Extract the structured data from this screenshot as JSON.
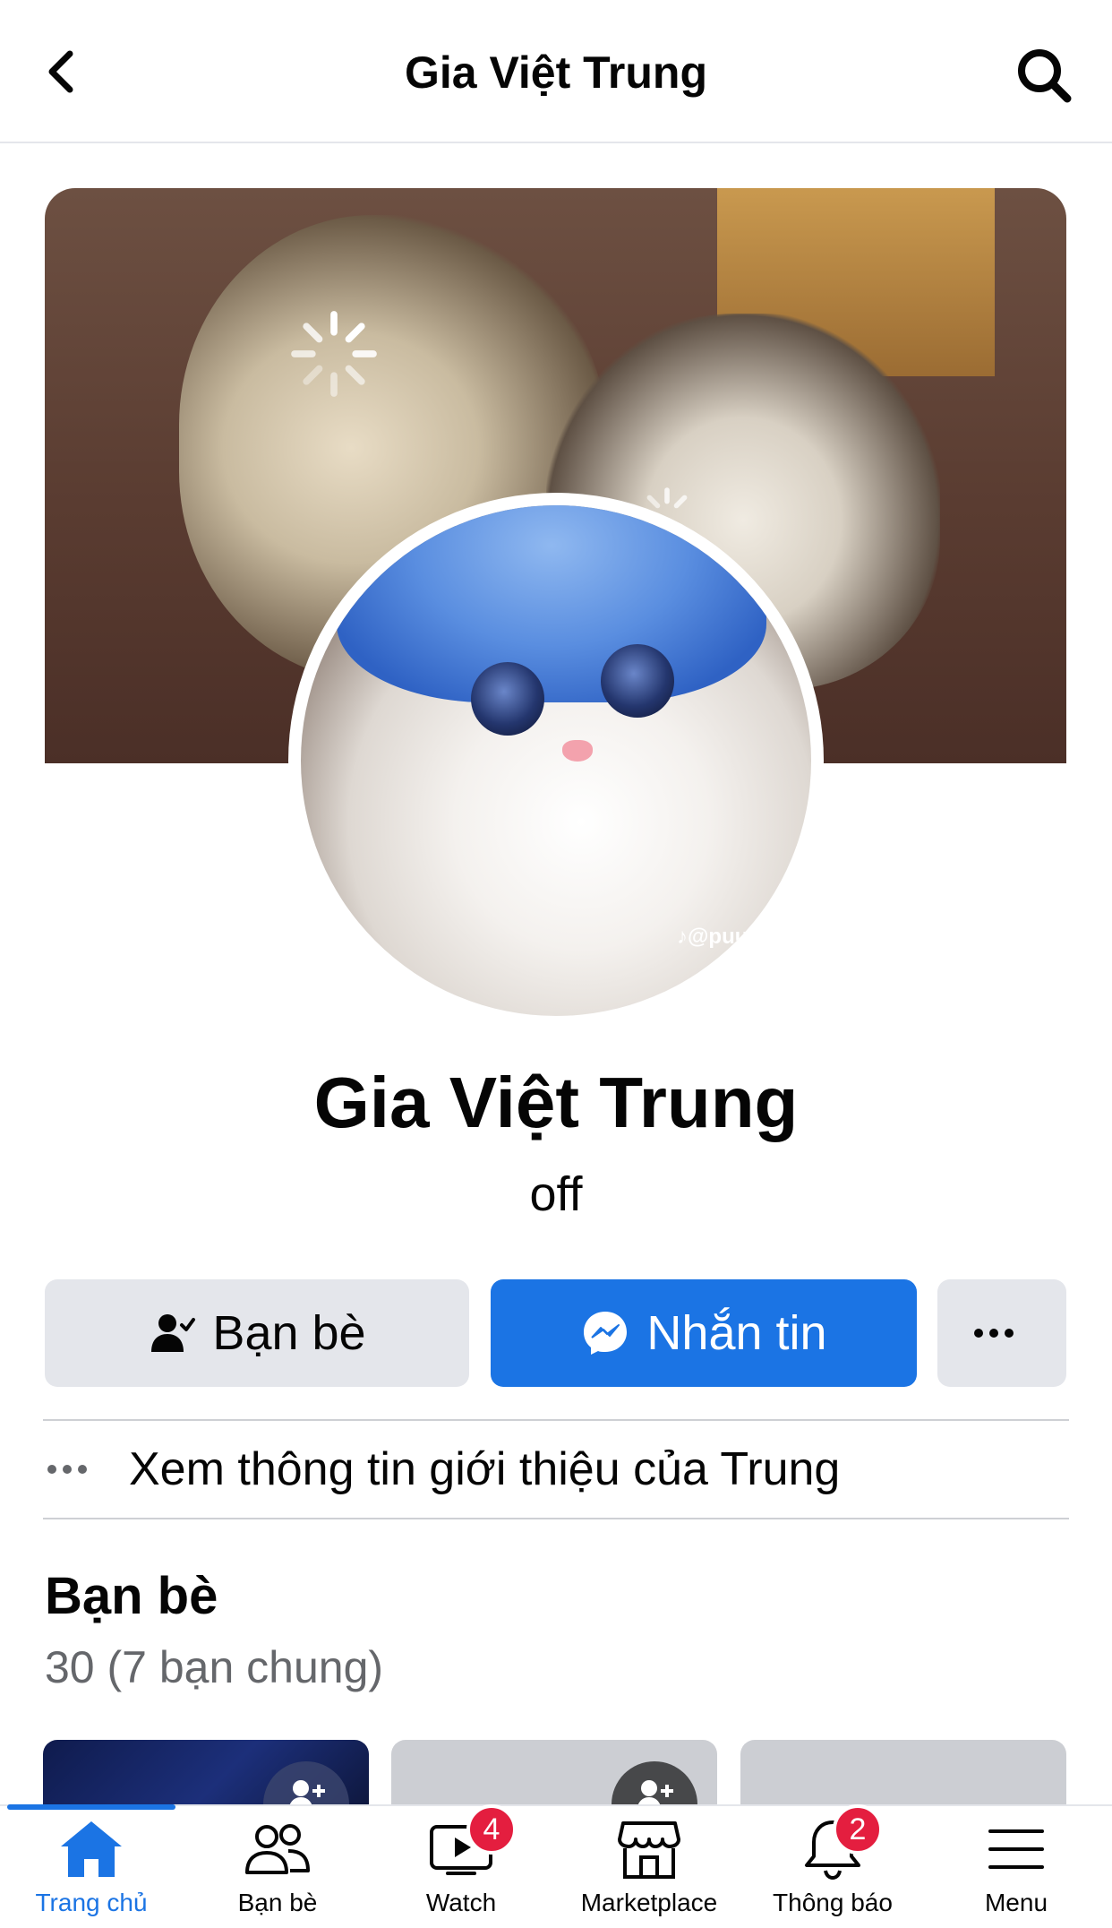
{
  "header": {
    "title": "Gia Việt Trung"
  },
  "profile": {
    "name": "Gia Việt Trung",
    "bio": "off",
    "avatar_watermark": "♪@puu"
  },
  "actions": {
    "friends_label": "Bạn bè",
    "message_label": "Nhắn tin"
  },
  "about": {
    "label": "Xem thông tin giới thiệu của Trung"
  },
  "friends": {
    "title": "Bạn bè",
    "count": "30 (7 bạn chung)"
  },
  "tabs": [
    {
      "label": "Trang chủ",
      "icon": "home-icon",
      "active": true
    },
    {
      "label": "Bạn bè",
      "icon": "friends-icon"
    },
    {
      "label": "Watch",
      "icon": "watch-icon",
      "badge": "4"
    },
    {
      "label": "Marketplace",
      "icon": "marketplace-icon"
    },
    {
      "label": "Thông báo",
      "icon": "bell-icon",
      "badge": "2"
    },
    {
      "label": "Menu",
      "icon": "menu-icon"
    }
  ],
  "colors": {
    "accent": "#1b74e4",
    "badge": "#e41e3f",
    "secondary_button": "#e4e6eb"
  }
}
